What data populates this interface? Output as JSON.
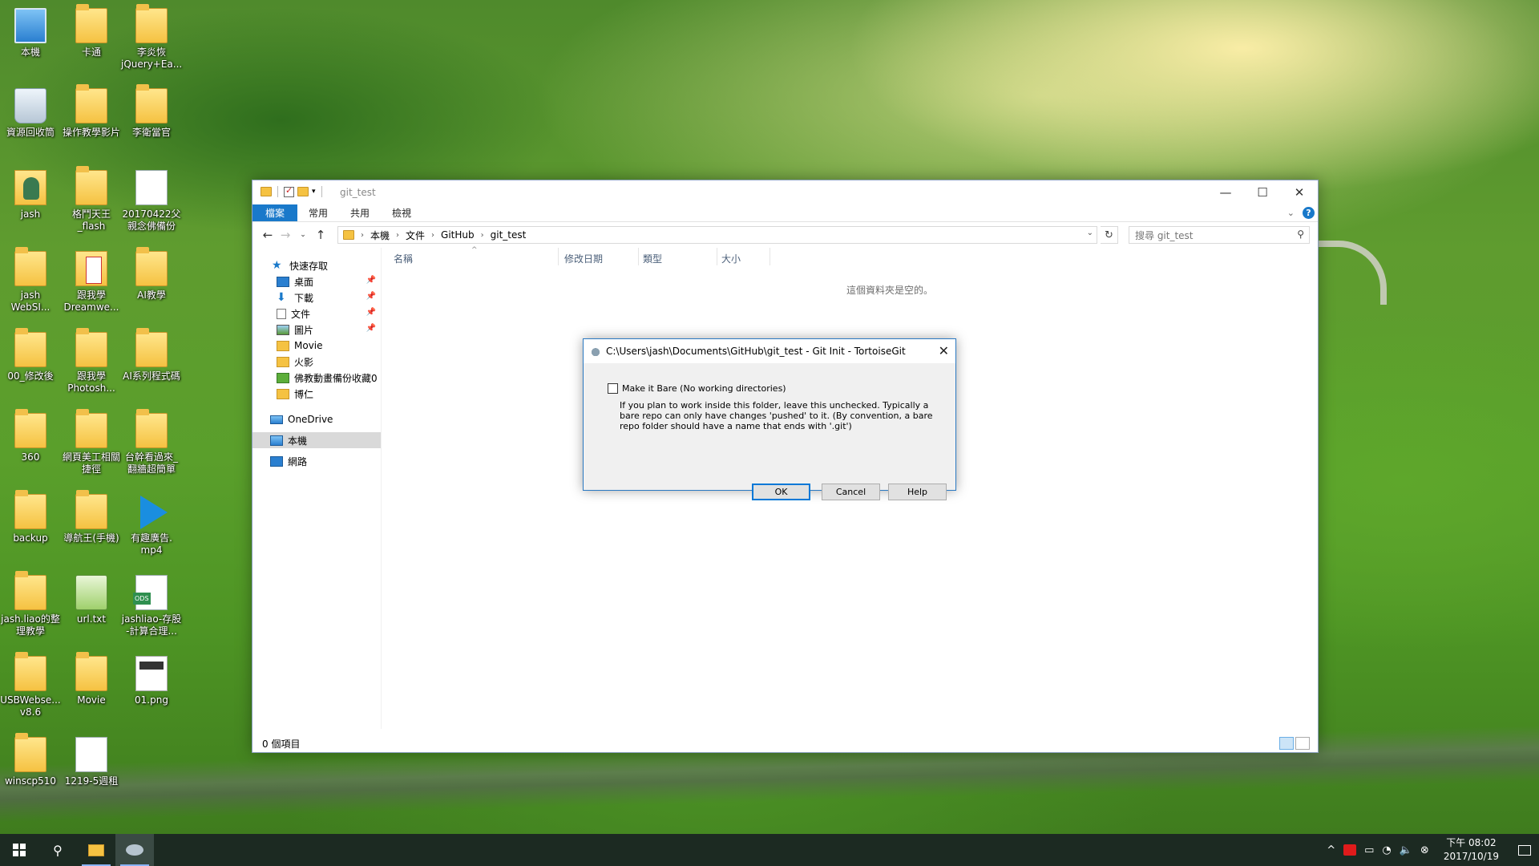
{
  "desktop": {
    "icons": [
      {
        "label": "本機"
      },
      {
        "label": "卡通"
      },
      {
        "label": "李炎恢 jQuery+Ea..."
      },
      {
        "label": "資源回收筒"
      },
      {
        "label": "操作教學影片"
      },
      {
        "label": "李衛當官"
      },
      {
        "label": "jash"
      },
      {
        "label": "格鬥天王 _flash"
      },
      {
        "label": "20170422父 親念佛備份"
      },
      {
        "label": "jash WebSI..."
      },
      {
        "label": "跟我學 Dreamwe..."
      },
      {
        "label": "AI教學"
      },
      {
        "label": "00_修改後"
      },
      {
        "label": "跟我學 Photosh..."
      },
      {
        "label": "AI系列程式碼"
      },
      {
        "label": "360"
      },
      {
        "label": "網頁美工相關 捷徑"
      },
      {
        "label": "台幹看過來_ 翻牆超簡單"
      },
      {
        "label": "backup"
      },
      {
        "label": "導航王(手機)"
      },
      {
        "label": "有趣廣告. mp4"
      },
      {
        "label": "jash.liao的整 理教學"
      },
      {
        "label": "url.txt"
      },
      {
        "label": "jashliao-存股 -計算合理..."
      },
      {
        "label": "USBWebse... v8.6"
      },
      {
        "label": "Movie"
      },
      {
        "label": "01.png"
      },
      {
        "label": "winscp510"
      },
      {
        "label": "1219-5週租"
      }
    ]
  },
  "explorer": {
    "title": "git_test",
    "ribbon_tabs": [
      "檔案",
      "常用",
      "共用",
      "檢視"
    ],
    "breadcrumb": [
      "本機",
      "文件",
      "GitHub",
      "git_test"
    ],
    "search_placeholder": "搜尋 git_test",
    "nav": {
      "quick_access": "快速存取",
      "items": [
        {
          "label": "桌面",
          "pinned": true
        },
        {
          "label": "下載",
          "pinned": true
        },
        {
          "label": "文件",
          "pinned": true
        },
        {
          "label": "圖片",
          "pinned": true
        },
        {
          "label": "Movie",
          "pinned": false
        },
        {
          "label": "火影",
          "pinned": false
        },
        {
          "label": "佛教動畫備份收藏0",
          "pinned": false
        },
        {
          "label": "博仁",
          "pinned": false
        }
      ],
      "onedrive": "OneDrive",
      "this_pc": "本機",
      "network": "網路"
    },
    "columns": [
      "名稱",
      "修改日期",
      "類型",
      "大小"
    ],
    "empty_message": "這個資料夾是空的。",
    "status": "0 個項目"
  },
  "dialog": {
    "title": "C:\\Users\\jash\\Documents\\GitHub\\git_test - Git Init - TortoiseGit",
    "checkbox_label": "Make it Bare (No working directories)",
    "checkbox_checked": false,
    "note": "If you plan to work inside this folder, leave this unchecked. Typically a bare repo can only have changes 'pushed' to it. (By convention, a bare repo folder should have a name that ends with '.git')",
    "ok": "OK",
    "cancel": "Cancel",
    "help": "Help"
  },
  "taskbar": {
    "time": "下午 08:02",
    "date": "2017/10/19"
  },
  "colors": {
    "accent": "#1979ca",
    "taskbar": "#1c2a22"
  }
}
